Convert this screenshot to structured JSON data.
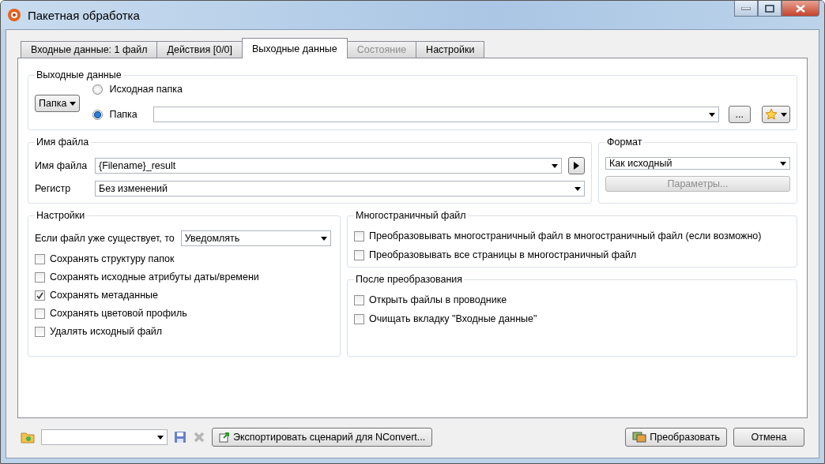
{
  "window": {
    "title": "Пакетная обработка"
  },
  "tabs": [
    {
      "label": "Входные данные: 1 файл",
      "selected": false,
      "disabled": false
    },
    {
      "label": "Действия [0/0]",
      "selected": false,
      "disabled": false
    },
    {
      "label": "Выходные данные",
      "selected": true,
      "disabled": false
    },
    {
      "label": "Состояние",
      "selected": false,
      "disabled": true
    },
    {
      "label": "Настройки",
      "selected": false,
      "disabled": false
    }
  ],
  "output": {
    "title": "Выходные данные",
    "mode": "Папка",
    "radios": [
      {
        "label": "Исходная папка",
        "selected": false
      },
      {
        "label": "Папка",
        "selected": true
      }
    ],
    "browse": "..."
  },
  "filename": {
    "title": "Имя файла",
    "name_label": "Имя файла",
    "name_value": "{Filename}_result",
    "case_label": "Регистр",
    "case_value": "Без изменений"
  },
  "format": {
    "title": "Формат",
    "value": "Как исходный",
    "params": "Параметры...",
    "params_disabled": true
  },
  "settings": {
    "title": "Настройки",
    "exists_label": "Если файл уже существует, то",
    "exists_value": "Уведомлять",
    "options": [
      {
        "label": "Сохранять структуру папок",
        "checked": false
      },
      {
        "label": "Сохранять исходные атрибуты даты/времени",
        "checked": false
      },
      {
        "label": "Сохранять метаданные",
        "checked": true
      },
      {
        "label": "Сохранять цветовой профиль",
        "checked": false
      },
      {
        "label": "Удалять исходный файл",
        "checked": false
      }
    ]
  },
  "multipage": {
    "title": "Многостраничный файл",
    "options": [
      {
        "label": "Преобразовывать многостраничный файл в многостраничный файл (если возможно)",
        "checked": false
      },
      {
        "label": "Преобразовывать все страницы в многостраничный файл",
        "checked": false
      }
    ]
  },
  "after": {
    "title": "После преобразования",
    "options": [
      {
        "label": "Открыть файлы в проводнике",
        "checked": false
      },
      {
        "label": "Очищать вкладку \"Входные данные\"",
        "checked": false
      }
    ]
  },
  "footer": {
    "export": "Экспортировать сценарий для NConvert...",
    "convert": "Преобразовать",
    "cancel": "Отмена"
  }
}
